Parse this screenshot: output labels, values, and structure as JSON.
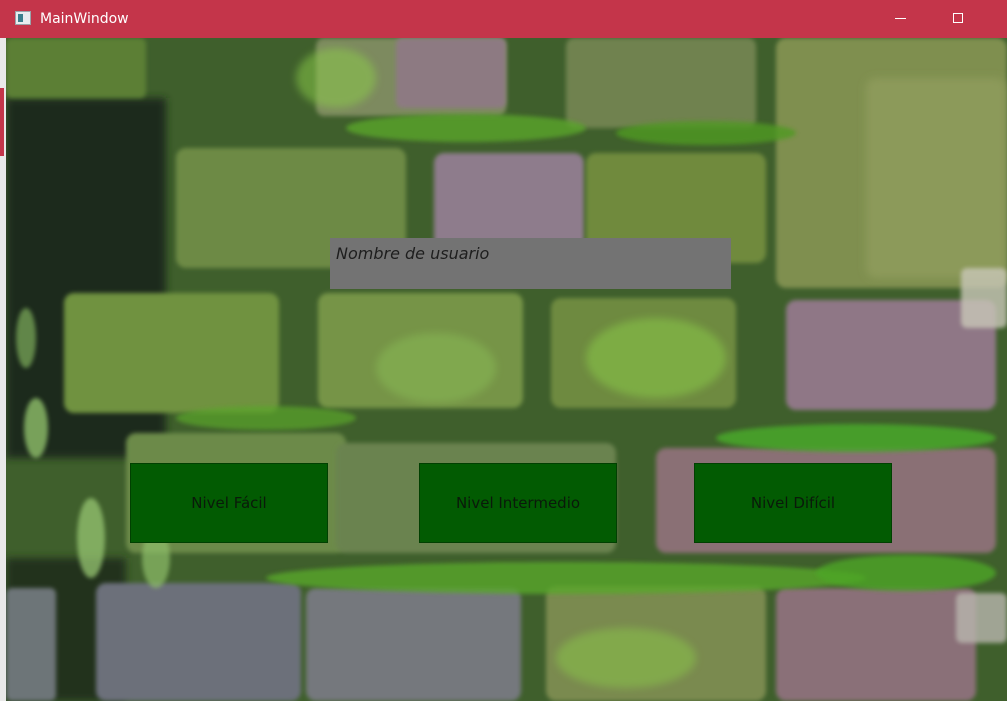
{
  "window": {
    "title": "MainWindow",
    "titlebar_color": "#c4354a",
    "icons": {
      "app": "app-window-icon",
      "minimize": "minimize-icon",
      "maximize": "maximize-icon"
    }
  },
  "form": {
    "username_placeholder": "Nombre de usuario",
    "username_value": ""
  },
  "levels": {
    "easy_label": "Nivel Fácil",
    "medium_label": "Nivel Intermedio",
    "hard_label": "Nivel Difícil"
  },
  "colors": {
    "field_background": "#737373",
    "button_background": "#025b02",
    "background_theme": "mossy stone wall"
  }
}
